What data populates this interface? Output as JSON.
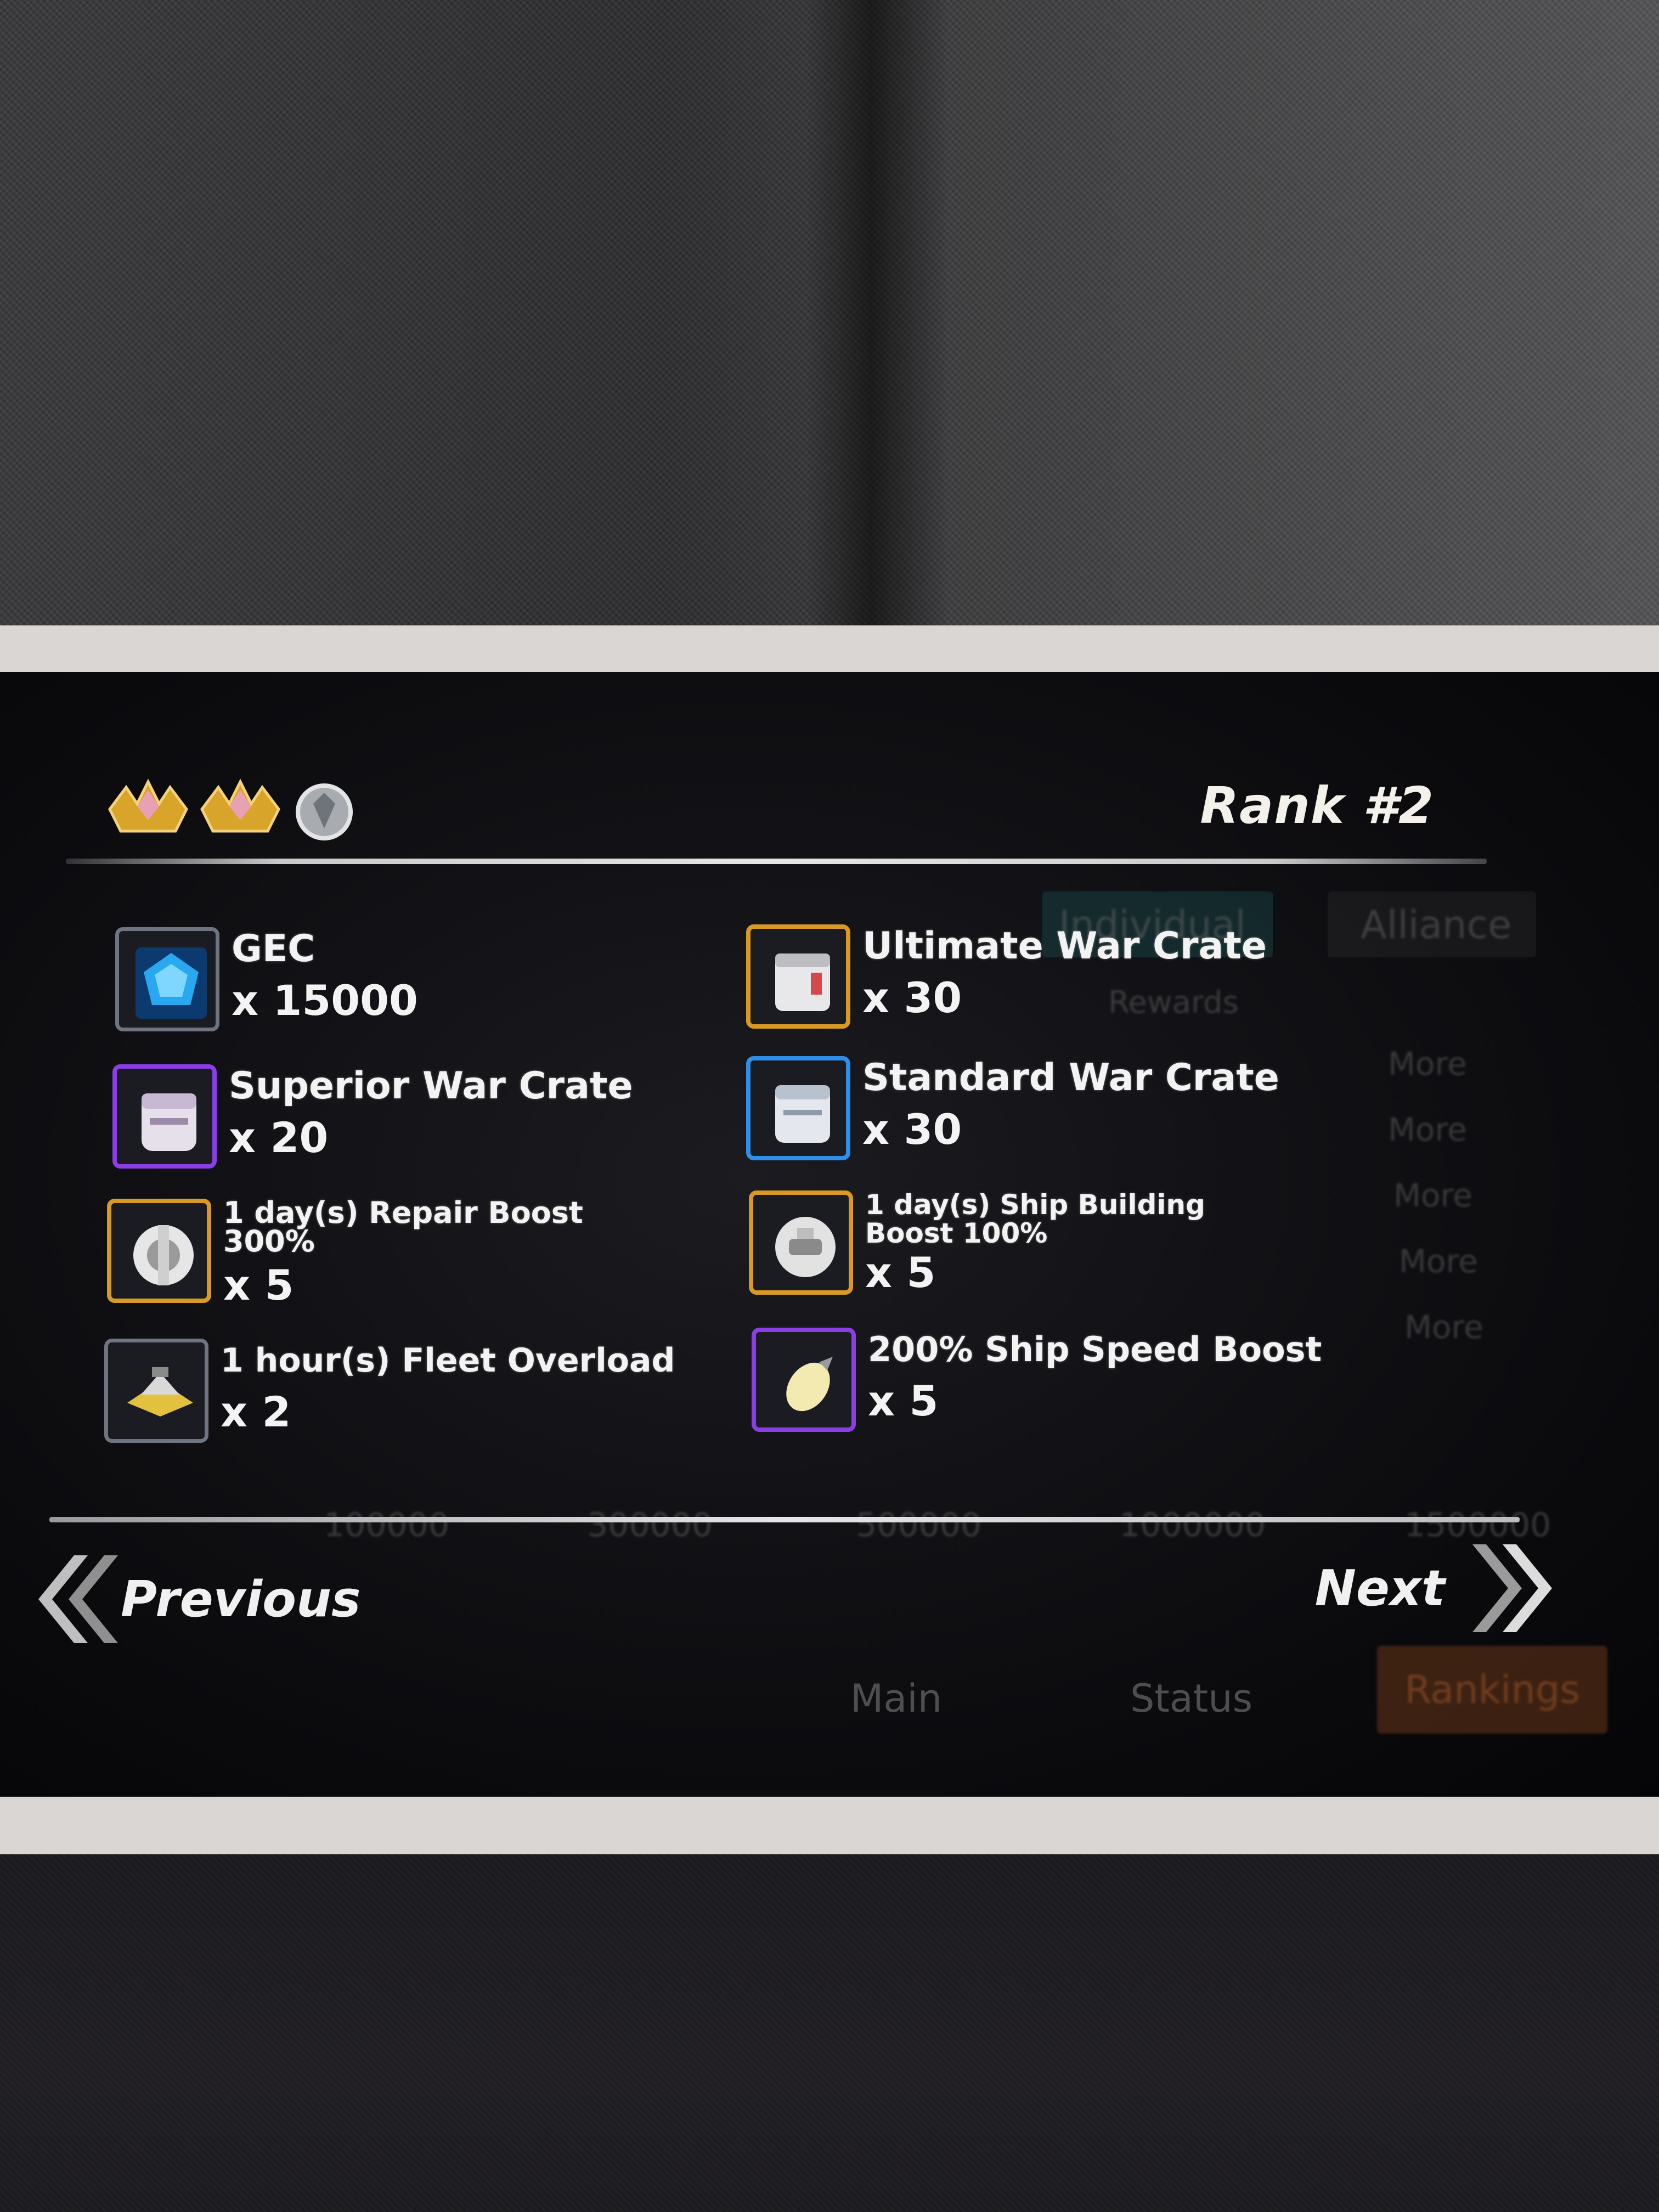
{
  "header": {
    "rank_label": "Rank #2"
  },
  "rewards": [
    {
      "name": "GEC",
      "qty": "x 15000",
      "icon": "gec-icon",
      "border": "#6e7480"
    },
    {
      "name": "Ultimate War Crate",
      "qty": "x 30",
      "icon": "ultimate-crate-icon",
      "border": "#d99a25"
    },
    {
      "name": "Superior War Crate",
      "qty": "x 20",
      "icon": "superior-crate-icon",
      "border": "#8b3ee6"
    },
    {
      "name": "Standard War Crate",
      "qty": "x 30",
      "icon": "standard-crate-icon",
      "border": "#2e8ee8"
    },
    {
      "name": "1 day(s) Repair Boost 300%",
      "qty": "x 5",
      "icon": "repair-boost-icon",
      "border": "#d99a25"
    },
    {
      "name": "1 day(s) Ship Building Boost 100%",
      "qty": "x 5",
      "icon": "ship-building-boost-icon",
      "border": "#d99a25"
    },
    {
      "name": "1 hour(s) Fleet Overload",
      "qty": "x 2",
      "icon": "fleet-overload-icon",
      "border": "#6e7480"
    },
    {
      "name": "200% Ship Speed Boost",
      "qty": "x 5",
      "icon": "ship-speed-boost-icon",
      "border": "#8b3ee6"
    }
  ],
  "nav": {
    "previous": "Previous",
    "next": "Next"
  },
  "background_ui": {
    "tabs": [
      "Individual",
      "Alliance"
    ],
    "rewards_label": "Rewards",
    "more": [
      "More",
      "More",
      "More",
      "More",
      "More"
    ],
    "thresholds": [
      "100000",
      "300000",
      "500000",
      "1000000",
      "1500000"
    ],
    "bottom_tabs": [
      "Main",
      "Status",
      "Rankings"
    ]
  }
}
